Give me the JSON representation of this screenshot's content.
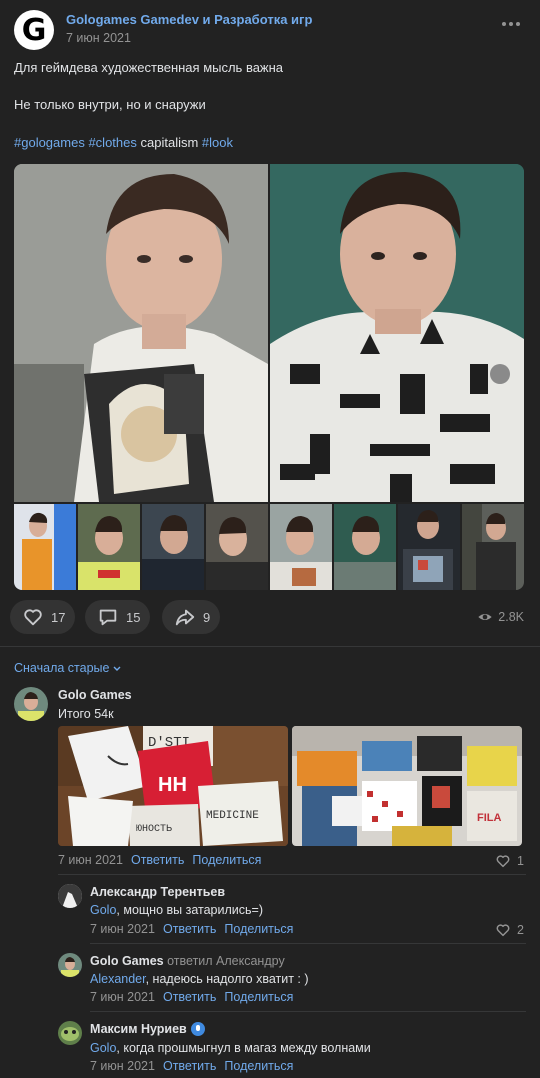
{
  "post": {
    "author": "Gologames Gamedev и Разработка игр",
    "date": "7 июн 2021",
    "line1": "Для геймдева художественная мысль важна",
    "line2": "Не только внутри, но и снаружи",
    "tags": [
      "#gologames",
      "#clothes",
      "capitalism",
      "#look"
    ],
    "avatar_letter": "G",
    "actions": {
      "likes": "17",
      "comments": "15",
      "shares": "9",
      "views": "2.8K"
    },
    "icons": {
      "more": "more-dots-icon",
      "like": "heart-icon",
      "comment": "comment-icon",
      "share": "share-icon",
      "views": "eye-icon"
    }
  },
  "sort_label": "Сначала старые",
  "comments": [
    {
      "author": "Golo Games",
      "text": "Итого 54к",
      "date": "7 июн 2021",
      "reply": "Ответить",
      "share": "Поделиться",
      "likes": "1"
    },
    {
      "author": "Александр Терентьев",
      "mention": "Golo",
      "text": ", мощно вы затарились=)",
      "date": "7 июн 2021",
      "reply": "Ответить",
      "share": "Поделиться",
      "likes": "2"
    },
    {
      "author": "Golo Games",
      "replied_to": "ответил Александру",
      "mention": "Alexander",
      "text": ", надеюсь надолго хватит : )",
      "date": "7 июн 2021",
      "reply": "Ответить",
      "share": "Поделиться"
    },
    {
      "author": "Максим Нуриев",
      "mention": "Golo",
      "text": ", когда прошмыгнул в магаз между волнами",
      "date": "7 июн 2021",
      "reply": "Ответить",
      "share": "Поделиться"
    }
  ],
  "photo_labels": {
    "bag_text": "HH",
    "box1": "MEDICINE",
    "box2": "ЮНОСТЬ",
    "box3": "D'STI",
    "fila": "FILA"
  },
  "colors": {
    "background": "#222222",
    "accent": "#71aaeb",
    "text": "#e1e3e6",
    "muted": "#939393"
  }
}
